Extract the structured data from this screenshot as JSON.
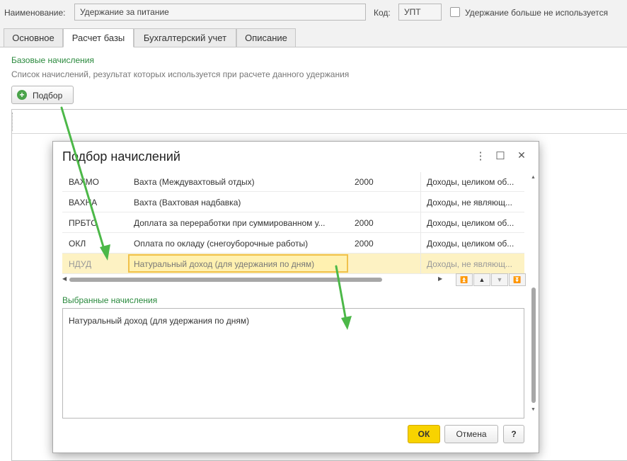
{
  "header": {
    "name_label": "Наименование:",
    "name_value": "Удержание за питание",
    "code_label": "Код:",
    "code_value": "УПТ",
    "unused_checkbox_label": "Удержание больше не используется"
  },
  "tabs": [
    {
      "label": "Основное"
    },
    {
      "label": "Расчет базы"
    },
    {
      "label": "Бухгалтерский учет"
    },
    {
      "label": "Описание"
    }
  ],
  "base": {
    "title": "Базовые начисления",
    "description": "Список начислений, результат которых используется при расчете данного удержания",
    "pick_button": "Подбор"
  },
  "dialog": {
    "title": "Подбор начислений",
    "rows": [
      {
        "code": "ВАХМО",
        "name": "Вахта (Междувахтовый отдых)",
        "num": "2000",
        "type": "Доходы, целиком об..."
      },
      {
        "code": "ВАХНА",
        "name": "Вахта (Вахтовая надбавка)",
        "num": "",
        "type": "Доходы, не являющ..."
      },
      {
        "code": "ПРБТС",
        "name": "Доплата за переработки при суммированном у...",
        "num": "2000",
        "type": "Доходы, целиком об..."
      },
      {
        "code": "ОКЛ",
        "name": "Оплата по окладу (снегоуборочные работы)",
        "num": "2000",
        "type": "Доходы, целиком об..."
      },
      {
        "code": "НДУД",
        "name": "Натуральный доход (для удержания по дням)",
        "num": "",
        "type": "Доходы, не являющ..."
      }
    ],
    "selected_title": "Выбранные начисления",
    "selected_items": [
      "Натуральный доход (для удержания по дням)"
    ],
    "ok_label": "ОК",
    "cancel_label": "Отмена",
    "help_label": "?"
  },
  "colors": {
    "accent_green": "#2b8a3e",
    "selection_yellow": "#fdf2c3",
    "ok_yellow": "#f8d300",
    "annotation_arrow": "#4cb848"
  },
  "icons": [
    "plus-circle-icon",
    "more-icon",
    "maximize-icon",
    "close-icon",
    "scroll-left-icon",
    "scroll-right-icon",
    "move-first-icon",
    "move-up-icon",
    "move-down-icon",
    "move-last-icon"
  ]
}
